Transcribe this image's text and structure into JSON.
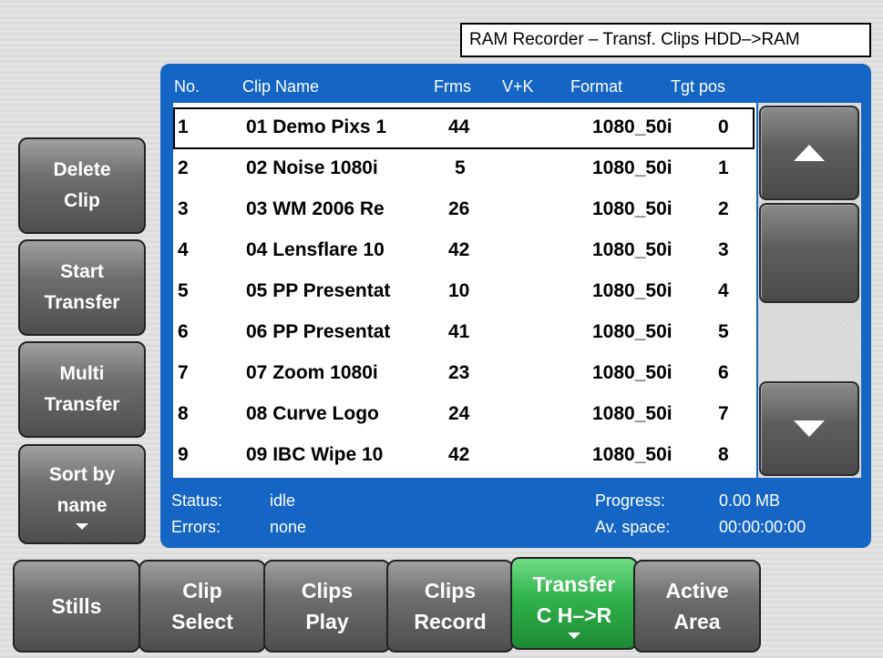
{
  "title": "RAM Recorder – Transf. Clips HDD–>RAM",
  "table": {
    "headers": [
      "No.",
      "Clip Name",
      "Frms",
      "V+K",
      "Format",
      "Tgt pos"
    ],
    "rows": [
      {
        "no": "1",
        "name": "01 Demo Pixs 1",
        "frms": "44",
        "vk": "",
        "format": "1080_50i",
        "tgt": "0"
      },
      {
        "no": "2",
        "name": "02 Noise 1080i",
        "frms": "5",
        "vk": "",
        "format": "1080_50i",
        "tgt": "1"
      },
      {
        "no": "3",
        "name": "03 WM 2006 Re",
        "frms": "26",
        "vk": "",
        "format": "1080_50i",
        "tgt": "2"
      },
      {
        "no": "4",
        "name": "04 Lensflare 10",
        "frms": "42",
        "vk": "",
        "format": "1080_50i",
        "tgt": "3"
      },
      {
        "no": "5",
        "name": "05 PP Presentat",
        "frms": "10",
        "vk": "",
        "format": "1080_50i",
        "tgt": "4"
      },
      {
        "no": "6",
        "name": "06 PP Presentat",
        "frms": "41",
        "vk": "",
        "format": "1080_50i",
        "tgt": "5"
      },
      {
        "no": "7",
        "name": "07 Zoom 1080i",
        "frms": "23",
        "vk": "",
        "format": "1080_50i",
        "tgt": "6"
      },
      {
        "no": "8",
        "name": "08 Curve Logo",
        "frms": "24",
        "vk": "",
        "format": "1080_50i",
        "tgt": "7"
      },
      {
        "no": "9",
        "name": "09 IBC Wipe 10",
        "frms": "42",
        "vk": "",
        "format": "1080_50i",
        "tgt": "8"
      }
    ],
    "selected_row": 1
  },
  "status": {
    "status_label": "Status:",
    "status_value": "idle",
    "errors_label": "Errors:",
    "errors_value": "none",
    "progress_label": "Progress:",
    "progress_value": "0.00 MB",
    "space_label": "Av. space:",
    "space_value": "00:00:00:00"
  },
  "left_buttons": {
    "delete": [
      "Delete",
      "Clip"
    ],
    "start": [
      "Start",
      "Transfer"
    ],
    "multi": [
      "Multi",
      "Transfer"
    ],
    "sort": [
      "Sort by",
      "name"
    ]
  },
  "bottom_buttons": {
    "stills": [
      "Stills"
    ],
    "clip_select": [
      "Clip",
      "Select"
    ],
    "clips_play": [
      "Clips",
      "Play"
    ],
    "clips_record": [
      "Clips",
      "Record"
    ],
    "transfer": [
      "Transfer",
      "C H–>R"
    ],
    "active_area": [
      "Active",
      "Area"
    ]
  },
  "icons": {
    "scroll_up": "triangle-up-icon",
    "scroll_down": "triangle-down-icon",
    "dropdown": "triangle-down-icon"
  },
  "colors": {
    "panel": "#1565c5",
    "active_button": "#2fb24b",
    "list_bg": "#ffffff"
  }
}
